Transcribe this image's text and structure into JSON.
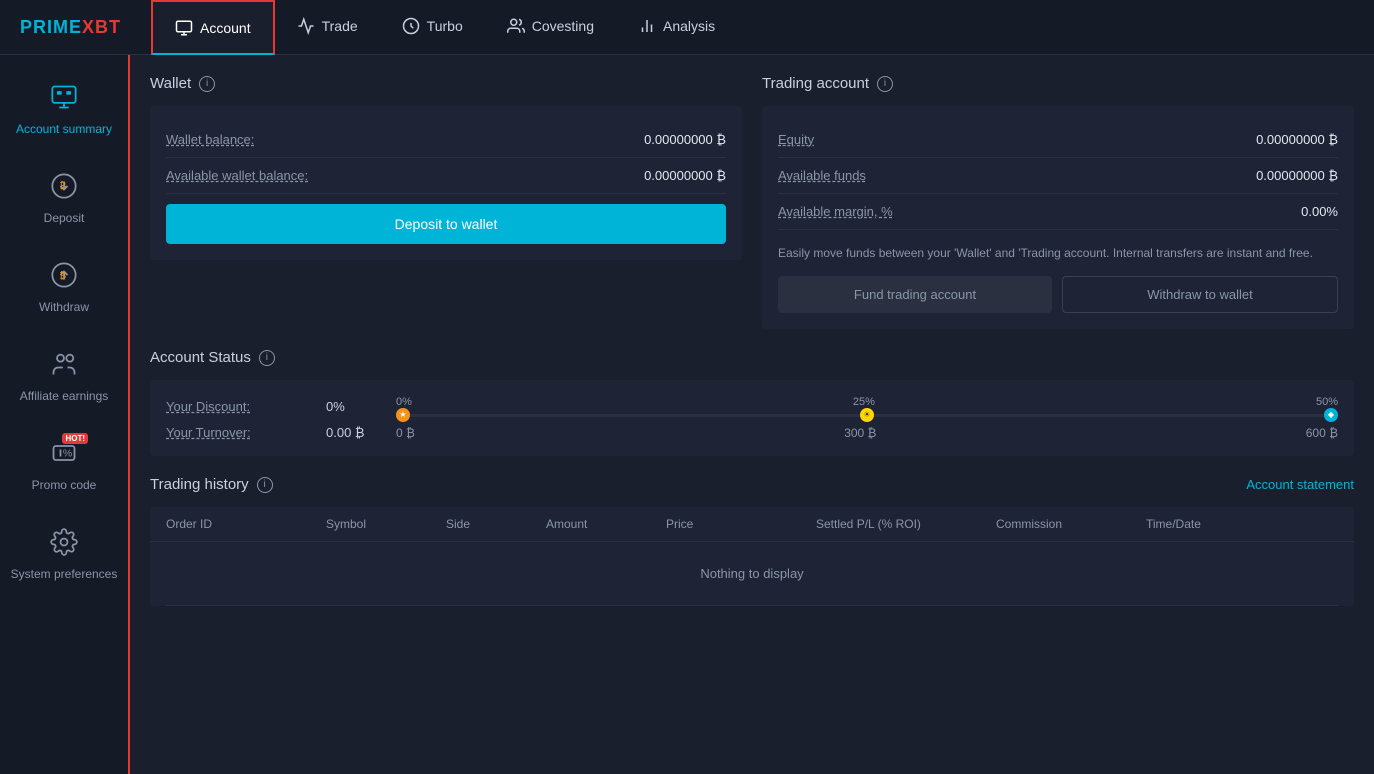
{
  "logo": {
    "main": "PRIME",
    "sub": "XBT"
  },
  "nav": {
    "items": [
      {
        "id": "account",
        "label": "Account",
        "active": true
      },
      {
        "id": "trade",
        "label": "Trade",
        "active": false
      },
      {
        "id": "turbo",
        "label": "Turbo",
        "active": false
      },
      {
        "id": "covesting",
        "label": "Covesting",
        "active": false
      },
      {
        "id": "analysis",
        "label": "Analysis",
        "active": false
      }
    ]
  },
  "sidebar": {
    "items": [
      {
        "id": "account-summary",
        "label": "Account summary",
        "active": true
      },
      {
        "id": "deposit",
        "label": "Deposit",
        "active": false
      },
      {
        "id": "withdraw",
        "label": "Withdraw",
        "active": false
      },
      {
        "id": "affiliate-earnings",
        "label": "Affiliate earnings",
        "active": false
      },
      {
        "id": "promo-code",
        "label": "Promo code",
        "active": false,
        "hot": true
      },
      {
        "id": "system-preferences",
        "label": "System preferences",
        "active": false
      }
    ]
  },
  "wallet": {
    "title": "Wallet",
    "wallet_balance_label": "Wallet balance:",
    "wallet_balance_value": "0.00000000 ₿",
    "available_wallet_label": "Available wallet balance:",
    "available_wallet_value": "0.00000000 ₿",
    "deposit_btn": "Deposit to wallet"
  },
  "account_status": {
    "title": "Account Status",
    "discount_label": "Your Discount:",
    "discount_value": "0%",
    "levels": [
      "0%",
      "25%",
      "50%"
    ],
    "turnover_label": "Your Turnover:",
    "turnover_value": "0.00 ₿",
    "turnover_levels": [
      "0 ₿",
      "300 ₿",
      "600 ₿"
    ]
  },
  "trading_account": {
    "title": "Trading account",
    "equity_label": "Equity",
    "equity_value": "0.00000000 ₿",
    "available_funds_label": "Available funds",
    "available_funds_value": "0.00000000 ₿",
    "available_margin_label": "Available margin, %",
    "available_margin_value": "0.00%",
    "transfer_desc": "Easily move funds between your 'Wallet' and 'Trading account. Internal transfers are instant and free.",
    "fund_btn": "Fund trading account",
    "withdraw_btn": "Withdraw to wallet"
  },
  "trading_history": {
    "title": "Trading history",
    "account_statement": "Account statement",
    "columns": [
      "Order ID",
      "Symbol",
      "Side",
      "Amount",
      "Price",
      "Settled P/L (% ROI)",
      "Commission",
      "Time/Date"
    ],
    "empty_message": "Nothing to display"
  }
}
